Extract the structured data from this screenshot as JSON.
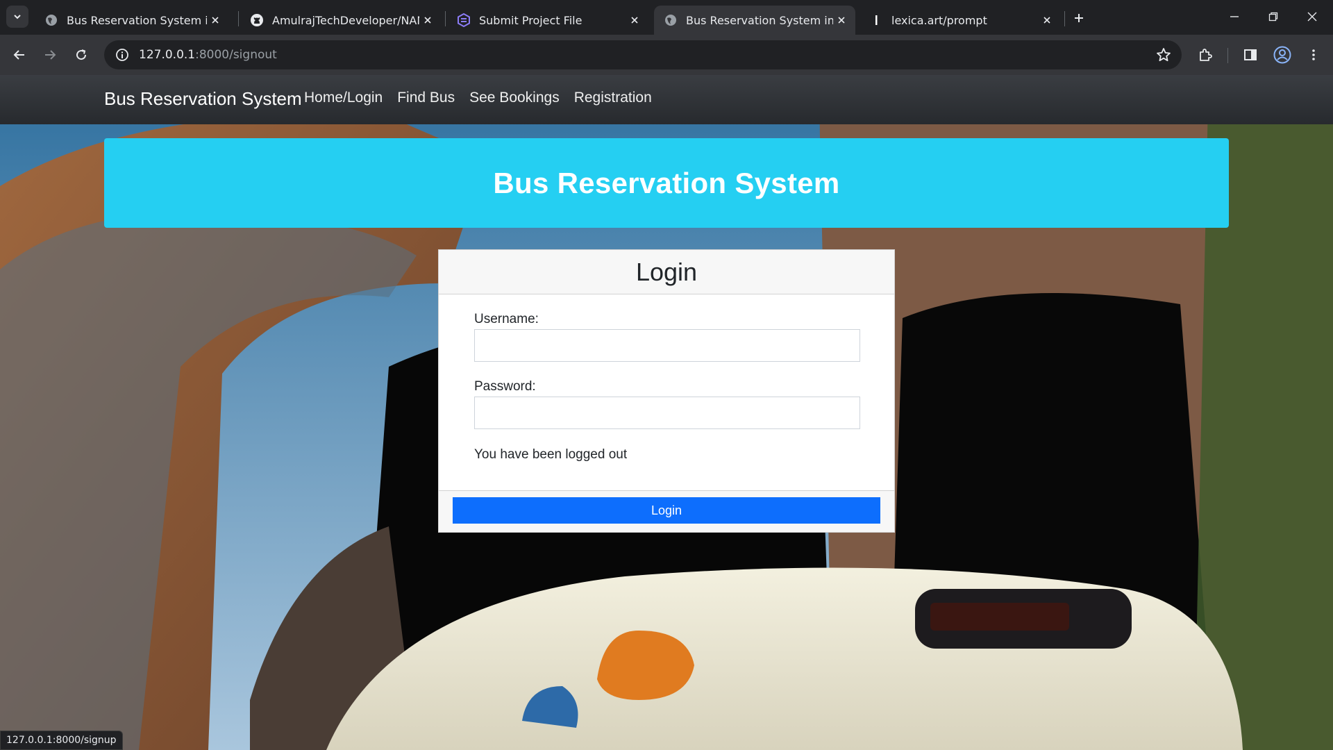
{
  "browser": {
    "tabs": [
      {
        "title": "Bus Reservation System in Djan",
        "favicon": "globe-icon",
        "active": false
      },
      {
        "title": "AmulrajTechDeveloper/NANMU",
        "favicon": "github-icon",
        "active": false
      },
      {
        "title": "Submit Project File",
        "favicon": "hexagon-icon",
        "active": false
      },
      {
        "title": "Bus Reservation System in Djan",
        "favicon": "globe-icon",
        "active": true
      },
      {
        "title": "lexica.art/prompt",
        "favicon": "lexica-icon",
        "active": false
      }
    ],
    "address": {
      "host": "127.0.0.1",
      "path": ":8000/signout"
    },
    "status_url": "127.0.0.1:8000/signup"
  },
  "navbar": {
    "brand": "Bus Reservation System",
    "links": [
      "Home/Login",
      "Find Bus",
      "See Bookings",
      "Registration"
    ]
  },
  "banner": {
    "title": "Bus Reservation System"
  },
  "login": {
    "heading": "Login",
    "username_label": "Username:",
    "username_value": "",
    "password_label": "Password:",
    "password_value": "",
    "message": "You have been logged out",
    "button_label": "Login"
  },
  "colors": {
    "banner": "#25cff2",
    "primary_button": "#0d6efd",
    "navbar": "#2f3236"
  }
}
